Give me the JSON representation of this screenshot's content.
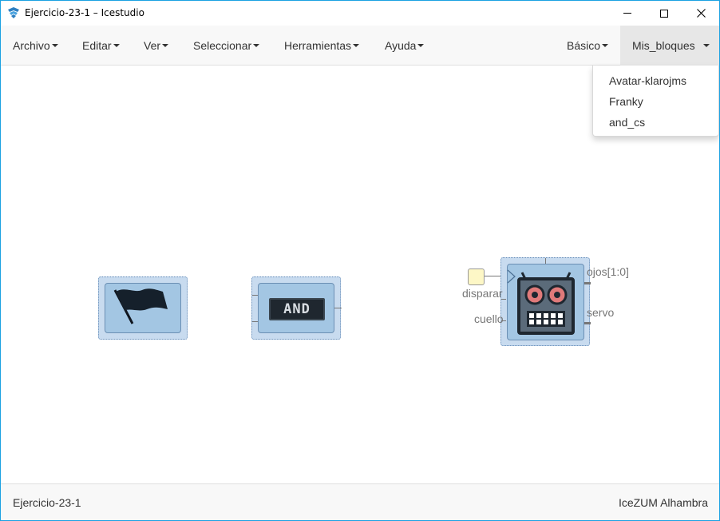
{
  "window": {
    "title": "Ejercicio-23-1 – Icestudio",
    "accent": "#1ba1e2"
  },
  "menubar": {
    "items": [
      {
        "label": "Archivo"
      },
      {
        "label": "Editar"
      },
      {
        "label": "Ver"
      },
      {
        "label": "Seleccionar"
      },
      {
        "label": "Herramientas"
      },
      {
        "label": "Ayuda"
      }
    ],
    "right_items": [
      {
        "label": "Básico"
      },
      {
        "label": "Mis_bloques"
      }
    ]
  },
  "dropdown": {
    "items": [
      {
        "label": "Avatar-klarojms"
      },
      {
        "label": "Franky"
      },
      {
        "label": "and_cs"
      }
    ]
  },
  "canvas": {
    "blocks": [
      {
        "name": "flag-block",
        "icon": "flag-icon"
      },
      {
        "name": "and-block",
        "icon": "and-gate-icon",
        "text": "AND"
      },
      {
        "name": "robot-block",
        "icon": "robot-icon"
      }
    ],
    "robot_ports": {
      "inputs": [
        {
          "label": "disparar"
        },
        {
          "label": "cuello"
        }
      ],
      "outputs": [
        {
          "label": "ojos[1:0]"
        },
        {
          "label": "servo"
        }
      ]
    }
  },
  "footer": {
    "project": "Ejercicio-23-1",
    "board": "IceZUM Alhambra"
  }
}
